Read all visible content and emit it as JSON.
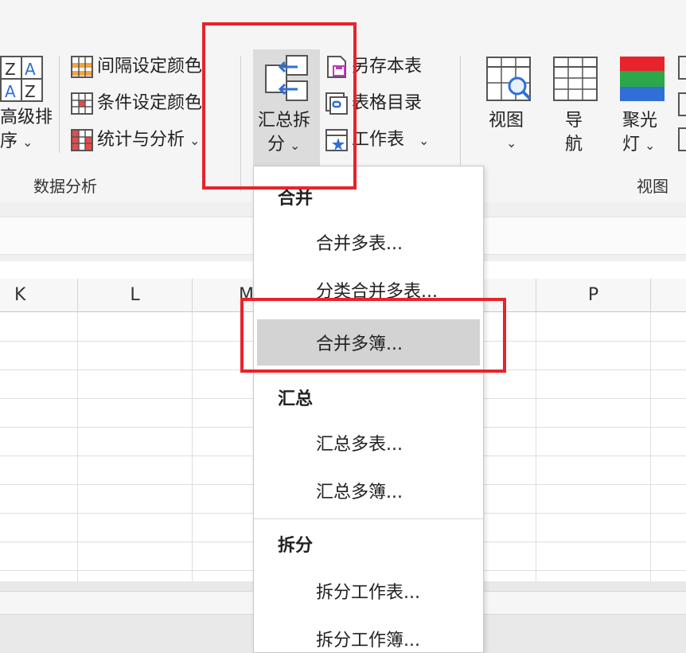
{
  "ribbon": {
    "advanced_sort": {
      "line1": "高级排",
      "line2": "序",
      "chevron": "⌄"
    },
    "color_items": [
      {
        "label": "间隔设定颜色",
        "icon": "alternate-color-grid-icon"
      },
      {
        "label": "条件设定颜色",
        "icon": "conditional-color-grid-icon"
      },
      {
        "label": "统计与分析",
        "icon": "statistics-grid-icon"
      }
    ],
    "data_analysis_label": "数据分析",
    "summarize_split": {
      "line1": "汇总拆",
      "line2": "分",
      "chevron": "⌄"
    },
    "save_sheet": "另存本表",
    "table_directory": "表格目录",
    "worksheet": "工作表",
    "chevron": "⌄",
    "view": {
      "label": "视图",
      "chevron": "⌄"
    },
    "navigation": {
      "line1": "导",
      "line2": "航"
    },
    "spotlight": {
      "line1": "聚光",
      "line2": "灯"
    },
    "view_group_label": "视图"
  },
  "sheet": {
    "columns": [
      "K",
      "L",
      "M",
      "",
      "P"
    ]
  },
  "menu": {
    "merge_header": "合并",
    "merge_items": [
      "合并多表...",
      "分类合并多表...",
      "合并多簿..."
    ],
    "summary_header": "汇总",
    "summary_items": [
      "汇总多表...",
      "汇总多簿..."
    ],
    "split_header": "拆分",
    "split_items": [
      "拆分工作表...",
      "拆分工作簿..."
    ]
  },
  "colors": {
    "annotation_red": "#e8232b",
    "highlight_gray": "#d3d3d3",
    "icon_blue": "#2f6fd6"
  }
}
